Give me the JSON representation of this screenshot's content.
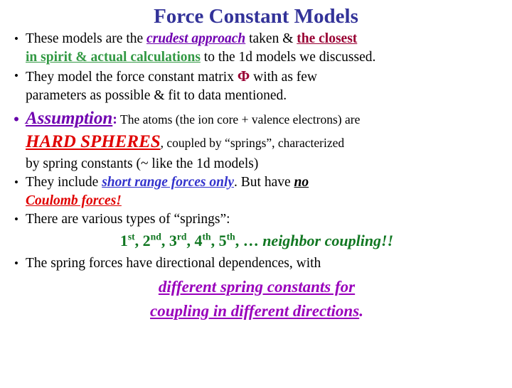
{
  "slide": {
    "title": "Force Constant Models",
    "title_color": "#333399",
    "background": "#ffffff"
  },
  "bullets": [
    {
      "id": "bullet-1",
      "marker": "•",
      "marker_style": "black-small",
      "lines": [
        {
          "runs": [
            {
              "text": "These models are the ",
              "style": "plain"
            },
            {
              "text": "crudest approach",
              "style": "purple-bold-italic-underline",
              "color": "#7000b0"
            },
            {
              "text": " taken & ",
              "style": "plain"
            },
            {
              "text": "the closest",
              "style": "maroon-bold-underline",
              "color": "#990033"
            }
          ]
        },
        {
          "runs": [
            {
              "text": "in spirit & actual calculations",
              "style": "green-bold-underline",
              "color": "#339944"
            },
            {
              "text": " to the 1d models we discussed.",
              "style": "plain"
            }
          ]
        }
      ]
    },
    {
      "id": "bullet-2",
      "marker": "•",
      "marker_style": "black-small",
      "lines": [
        {
          "runs": [
            {
              "text": "They model the force constant matrix ",
              "style": "plain"
            },
            {
              "text": "Φ",
              "style": "maroon-bold-symbol",
              "color": "#990033"
            },
            {
              "text": " with as few",
              "style": "plain"
            }
          ]
        },
        {
          "runs": [
            {
              "text": "parameters as possible & fit to data mentioned.",
              "style": "plain"
            }
          ]
        }
      ]
    },
    {
      "id": "bullet-3",
      "marker": "•",
      "marker_style": "purple-large",
      "lines": [
        {
          "runs": [
            {
              "text": "Assumption",
              "style": "purple-large-bold-italic-underline",
              "color": "#7000b0"
            },
            {
              "text": ":",
              "style": "purple-colon",
              "color": "#7000b0"
            },
            {
              "text": " The atoms (the ion core + valence electrons) are",
              "style": "small-plain"
            }
          ]
        },
        {
          "runs": [
            {
              "text": "HARD SPHERES",
              "style": "red-large-bold-italic-underline",
              "color": "#e00000"
            },
            {
              "text": ", coupled by “springs”, characterized",
              "style": "small-plain"
            }
          ]
        },
        {
          "runs": [
            {
              "text": "by spring constants (~ like the 1d models)",
              "style": "plain"
            }
          ]
        }
      ]
    },
    {
      "id": "bullet-4",
      "marker": "•",
      "marker_style": "black-small",
      "lines": [
        {
          "runs": [
            {
              "text": "They include ",
              "style": "plain"
            },
            {
              "text": "short range forces only",
              "style": "blue-bold-italic-underline",
              "color": "#3333cc"
            },
            {
              "text": ". But have ",
              "style": "plain"
            },
            {
              "text": "no",
              "style": "black-bold-italic-underline",
              "color": "#000000"
            }
          ]
        },
        {
          "runs": [
            {
              "text": "Coulomb forces!",
              "style": "red-bold-italic-underline",
              "color": "#e00000"
            }
          ]
        }
      ]
    },
    {
      "id": "bullet-5",
      "marker": "•",
      "marker_style": "black-small",
      "lines": [
        {
          "runs": [
            {
              "text": "There are various types of “springs”:",
              "style": "plain"
            }
          ]
        }
      ]
    }
  ],
  "emphasis_line": {
    "id": "neighbor-coupling-line",
    "color": "#117722",
    "ordinals": [
      {
        "number": "1",
        "suffix": "st"
      },
      {
        "number": "2",
        "suffix": "nd"
      },
      {
        "number": "3",
        "suffix": "rd"
      },
      {
        "number": "4",
        "suffix": "th"
      },
      {
        "number": "5",
        "suffix": "th"
      }
    ],
    "separator": ", ",
    "ellipsis": ", … ",
    "tail": "neighbor coupling!!"
  },
  "bullet_last": {
    "id": "bullet-6",
    "marker": "•",
    "text": "The spring forces have directional dependences, with"
  },
  "closing": {
    "id": "closing-statement",
    "color": "#9900bb",
    "line1": "different spring constants for",
    "line2_main": "coupling in different directions",
    "line2_period": "."
  }
}
